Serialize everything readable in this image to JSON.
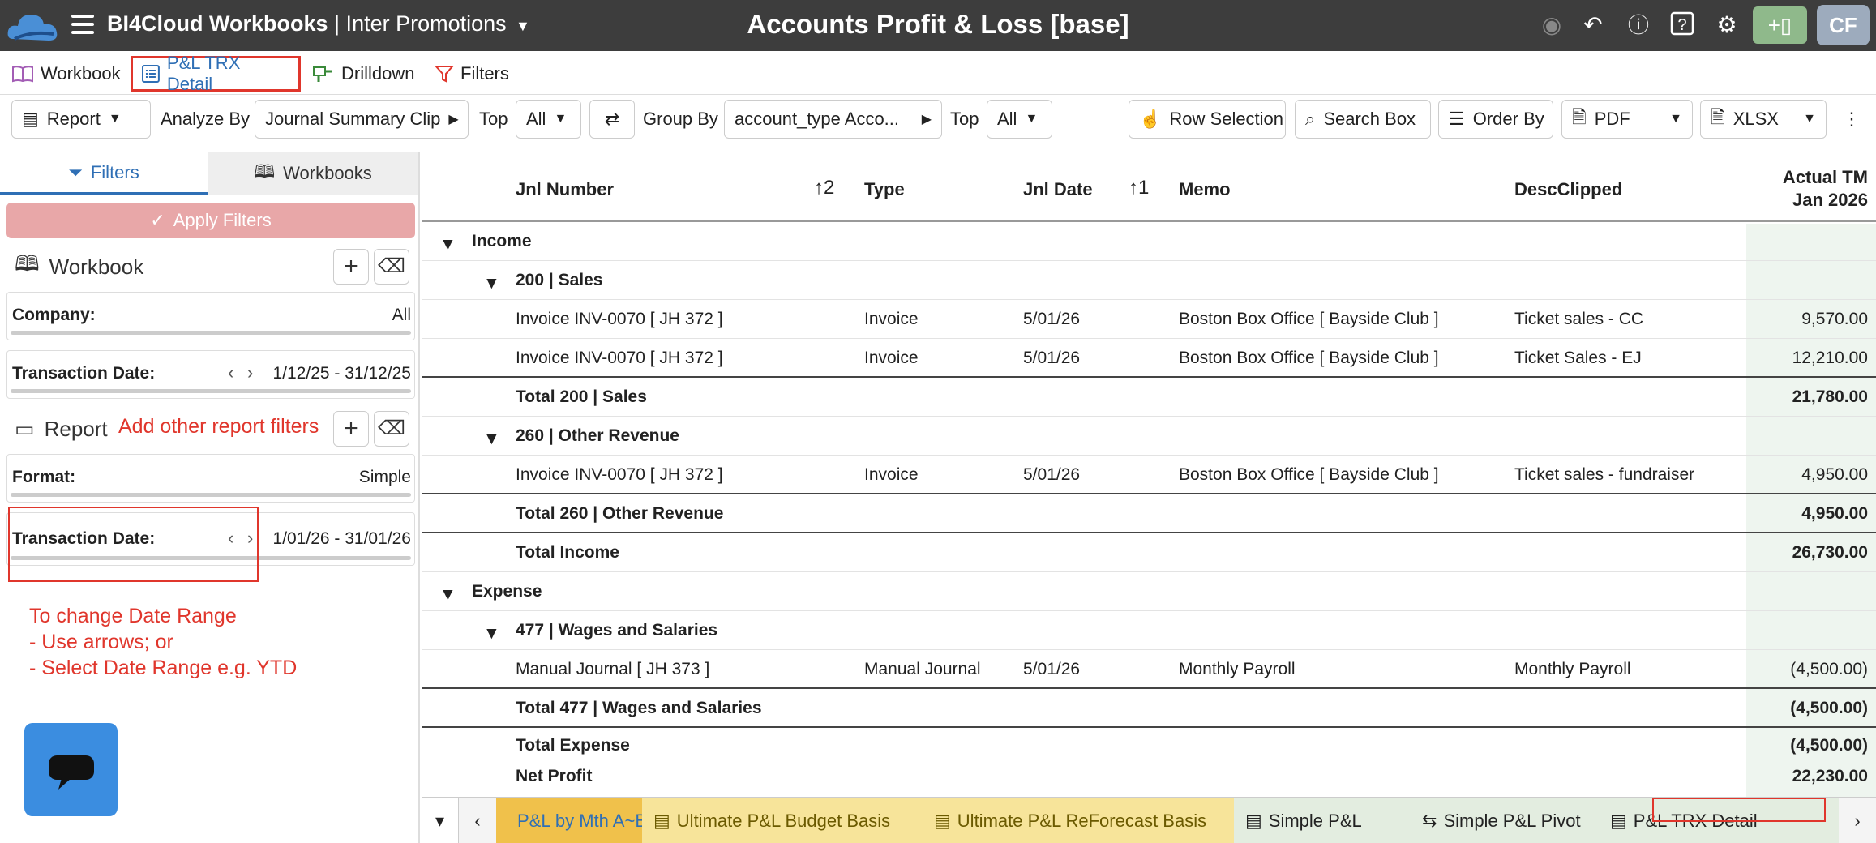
{
  "header": {
    "app_name": "BI4Cloud Workbooks",
    "org_name": "| Inter Promotions",
    "page_title": "Accounts Profit & Loss [base]",
    "avatar_initials": "CF"
  },
  "top_tabs": [
    {
      "label": "Workbook"
    },
    {
      "label": "P&L TRX Detail"
    },
    {
      "label": "Drilldown"
    },
    {
      "label": "Filters"
    }
  ],
  "toolbar": {
    "report_label": "Report",
    "analyze_by_label": "Analyze By",
    "analyze_by_value": "Journal Summary Clip",
    "top1_label": "Top",
    "top1_value": "All",
    "group_by_label": "Group By",
    "group_by_value": "account_type Acco...",
    "top2_label": "Top",
    "top2_value": "All",
    "row_selection": "Row Selection",
    "search_box": "Search Box",
    "order_by": "Order By",
    "pdf": "PDF",
    "xlsx": "XLSX"
  },
  "sidebar": {
    "tab_filters": "Filters",
    "tab_workbooks": "Workbooks",
    "apply_filters": "Apply Filters",
    "workbook_section": "Workbook",
    "company_label": "Company:",
    "company_value": "All",
    "wb_date_label": "Transaction Date:",
    "wb_date_value": "1/12/25 - 31/12/25",
    "report_section": "Report",
    "report_annotation": "Add other report filters",
    "format_label": "Format:",
    "format_value": "Simple",
    "rep_date_label": "Transaction Date:",
    "rep_date_value": "1/01/26 - 31/01/26",
    "help_line1": "To change Date Range",
    "help_line2": "- Use arrows; or",
    "help_line3": "- Select Date Range e.g. YTD"
  },
  "grid": {
    "headers": {
      "jnl_number": "Jnl Number",
      "sort2": "2",
      "type": "Type",
      "jnl_date": "Jnl Date",
      "sort1": "1",
      "memo": "Memo",
      "desc": "DescClipped",
      "actual_line1": "Actual TM",
      "actual_line2": "Jan 2026"
    },
    "rows": [
      {
        "label": "Income"
      },
      {
        "label": "200 | Sales"
      },
      {
        "jnl": "Invoice INV-0070 [ JH 372 ]",
        "type": "Invoice",
        "date": "5/01/26",
        "memo": "Boston Box Office [ Bayside Club ]",
        "desc": "Ticket sales - CC",
        "amount": "9,570.00"
      },
      {
        "jnl": "Invoice INV-0070 [ JH 372 ]",
        "type": "Invoice",
        "date": "5/01/26",
        "memo": "Boston Box Office [ Bayside Club ]",
        "desc": "Ticket Sales - EJ",
        "amount": "12,210.00"
      },
      {
        "label": "Total 200  | Sales",
        "amount": "21,780.00"
      },
      {
        "label": "260 | Other Revenue"
      },
      {
        "jnl": "Invoice INV-0070 [ JH 372 ]",
        "type": "Invoice",
        "date": "5/01/26",
        "memo": "Boston Box Office [ Bayside Club ]",
        "desc": "Ticket sales - fundraiser",
        "amount": "4,950.00"
      },
      {
        "label": "Total 260  | Other Revenue",
        "amount": "4,950.00"
      },
      {
        "label": "Total Income",
        "amount": "26,730.00"
      },
      {
        "label": "Expense"
      },
      {
        "label": "477 | Wages and Salaries"
      },
      {
        "jnl": "Manual Journal [ JH 373 ]",
        "type": "Manual Journal",
        "date": "5/01/26",
        "memo": "Monthly Payroll",
        "desc": "Monthly Payroll",
        "amount": "(4,500.00)"
      },
      {
        "label": "Total 477  | Wages and Salaries",
        "amount": "(4,500.00)"
      },
      {
        "label": "Total Expense",
        "amount": "(4,500.00)"
      },
      {
        "label": "Net Profit",
        "amount": "22,230.00"
      }
    ]
  },
  "sheet_tabs": [
    {
      "label": "P&L by Mth A~B",
      "color": "#f0c14b"
    },
    {
      "label": "Ultimate P&L Budget Basis",
      "color": "#f7e49a"
    },
    {
      "label": "Ultimate P&L ReForecast Basis",
      "color": "#f7e49a"
    },
    {
      "label": "Simple P&L",
      "color": "#e3ede0"
    },
    {
      "label": "Simple P&L Pivot",
      "color": "#e3ede0"
    },
    {
      "label": "P&L TRX Detail",
      "color": "#e3ede0"
    }
  ],
  "colors": {
    "accent": "#2f6fb5",
    "annotation_red": "#e0362c",
    "apply_button": "#e8a7a8",
    "titlebar": "#3d3d3d"
  }
}
